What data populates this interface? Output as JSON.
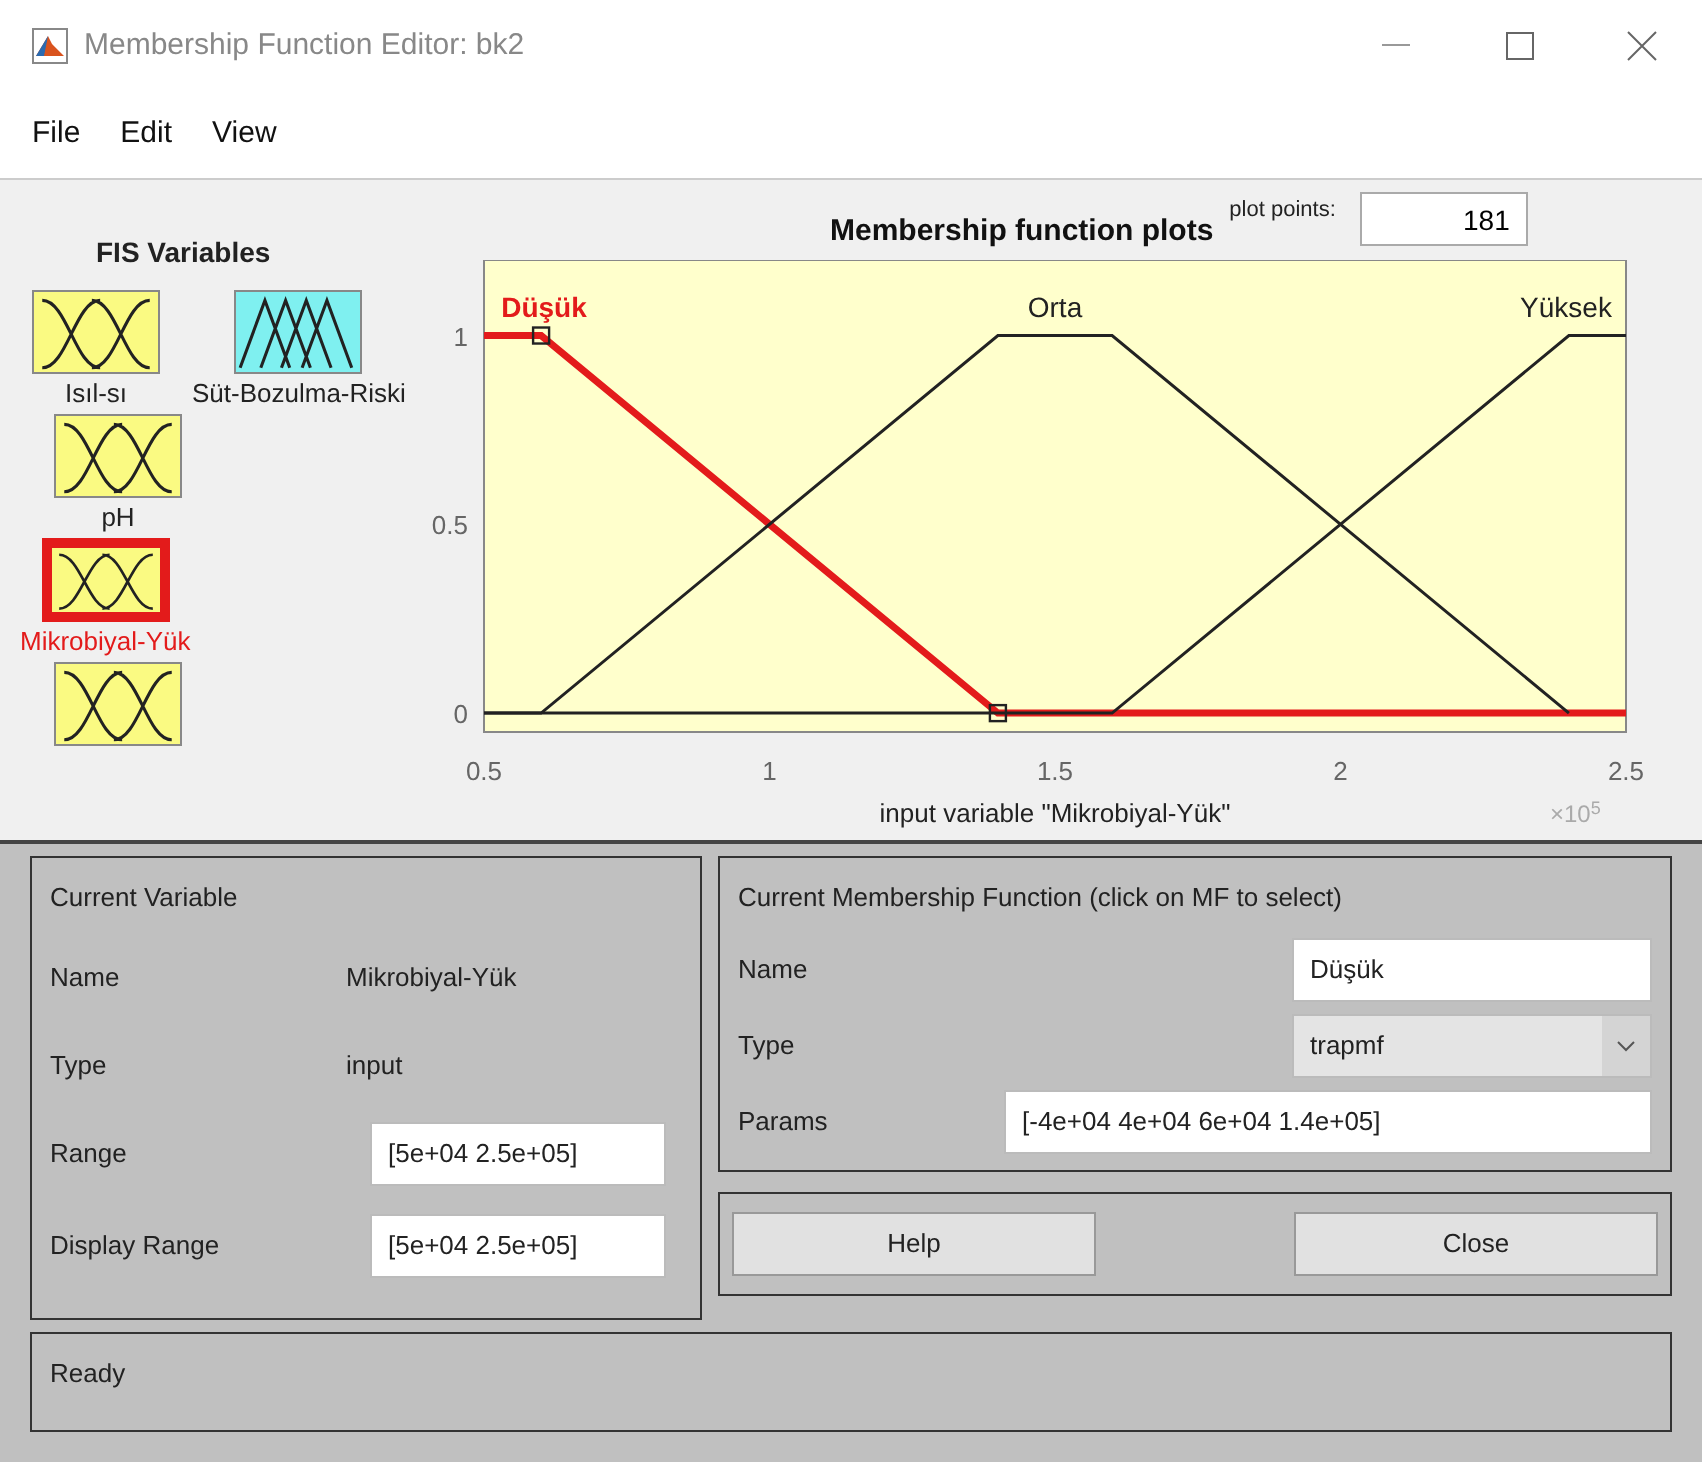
{
  "window": {
    "title": "Membership Function Editor: bk2"
  },
  "menu": [
    "File",
    "Edit",
    "View"
  ],
  "fis_variables": {
    "title": "FIS Variables",
    "items": [
      {
        "label": "Isıl-sı",
        "kind": "input",
        "selected": false
      },
      {
        "label": "Süt-Bozulma-Riski",
        "kind": "output",
        "selected": false
      },
      {
        "label": "pH",
        "kind": "input",
        "selected": false
      },
      {
        "label": "Mikrobiyal-Yük",
        "kind": "input",
        "selected": true
      },
      {
        "kind": "input",
        "selected": false
      }
    ]
  },
  "plot": {
    "curves": [
      {
        "selected": true
      },
      {
        "selected": false
      },
      {
        "selected": false
      }
    ],
    "plot_points_label": "plot points:",
    "plot_points": "181",
    "exponent": "×10$^{5}$",
    "chart_data": {
      "type": "line",
      "title": "Membership function plots",
      "xlabel": "input variable \"Mikrobiyal-Yük\"",
      "x": [
        0.5,
        0.6,
        1.4,
        1.6,
        2.4,
        2.5
      ],
      "xlim": [
        0.5,
        2.5
      ],
      "ylim": [
        -0.05,
        1.2
      ],
      "xticks": [
        {
          "value": 0.5,
          "label": "0.5"
        },
        {
          "value": 1,
          "label": "1"
        },
        {
          "value": 1.5,
          "label": "1.5"
        },
        {
          "value": 2,
          "label": "2"
        },
        {
          "value": 2.5,
          "label": "2.5"
        }
      ],
      "yticks": [
        {
          "value": 0,
          "label": "0"
        },
        {
          "value": 0.5,
          "label": "0.5"
        },
        {
          "value": 1,
          "label": "1"
        }
      ],
      "series": [
        {
          "name": "Düşük",
          "color": "#e31b1b",
          "values": [
            1,
            1,
            0,
            0,
            0,
            0
          ]
        },
        {
          "name": "Orta",
          "color": "#222222",
          "values": [
            0,
            0,
            1,
            1,
            0,
            null
          ]
        },
        {
          "name": "Yüksek",
          "color": "#222222",
          "values": [
            0,
            0,
            0,
            0,
            1,
            1
          ]
        }
      ]
    }
  },
  "current_variable": {
    "title": "Current Variable",
    "name_label": "Name",
    "name": "Mikrobiyal-Yük",
    "type_label": "Type",
    "type": "input",
    "range_label": "Range",
    "range": "[5e+04 2.5e+05]",
    "display_range_label": "Display Range",
    "display_range": "[5e+04 2.5e+05]"
  },
  "current_mf": {
    "title": "Current Membership Function (click on MF to select)",
    "name_label": "Name",
    "name": "Düşük",
    "type_label": "Type",
    "type": "trapmf",
    "params_label": "Params",
    "params": "[-4e+04 4e+04 6e+04 1.4e+05]"
  },
  "buttons": [
    "Help",
    "Close"
  ],
  "status_bar": "Ready"
}
